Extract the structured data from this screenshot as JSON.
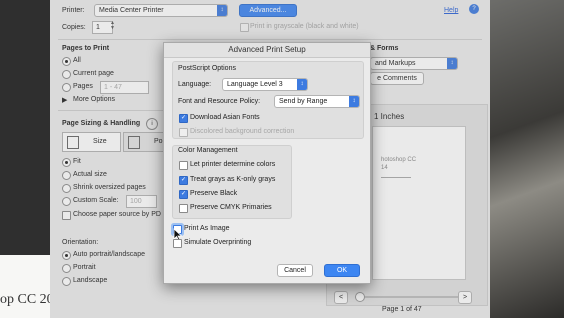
{
  "left_doc": {
    "text": "op CC 20"
  },
  "print": {
    "printer_label": "Printer:",
    "printer_value": "Media Center Printer",
    "advanced_button": "Advanced...",
    "help_link": "Help",
    "copies_label": "Copies:",
    "copies_value": "1",
    "grayscale_label": "Print in grayscale (black and white)",
    "pages_title": "Pages to Print",
    "pages_options": [
      "All",
      "Current page",
      "Pages"
    ],
    "pages_range": "1 - 47",
    "more_options": "More Options",
    "sizing_title": "Page Sizing & Handling",
    "size_tab": "Size",
    "poster_tab": "Po",
    "sizing_options": [
      "Fit",
      "Actual size",
      "Shrink oversized pages",
      "Custom Scale:"
    ],
    "custom_scale_value": "100",
    "choose_paper": "Choose paper source by PD",
    "orientation_title": "Orientation:",
    "orientation_options": [
      "Auto portrait/landscape",
      "Portrait",
      "Landscape"
    ],
    "forms_title": "& Forms",
    "forms_value": "and Markups",
    "comments_button": "e Comments",
    "inches_label": "1 Inches",
    "preview_text_1": "hotoshop CC",
    "preview_text_2": "14",
    "prev_button": "<",
    "next_button": ">",
    "page_status": "Page 1 of 47"
  },
  "modal": {
    "title": "Advanced Print Setup",
    "postscript_title": "PostScript Options",
    "language_label": "Language:",
    "language_value": "Language Level 3",
    "font_policy_label": "Font and Resource Policy:",
    "font_policy_value": "Send by Range",
    "download_fonts": "Download Asian Fonts",
    "discolored_bg": "Discolored background correction",
    "color_title": "Color Management",
    "color_options": [
      "Let printer determine colors",
      "Treat grays as K-only grays",
      "Preserve Black",
      "Preserve CMYK Primaries"
    ],
    "print_as_image": "Print As Image",
    "simulate_overprinting": "Simulate Overprinting",
    "cancel_button": "Cancel",
    "ok_button": "OK"
  },
  "colors": {
    "accent": "#3d86f2",
    "checkbox_blue": "#3d7be0"
  }
}
